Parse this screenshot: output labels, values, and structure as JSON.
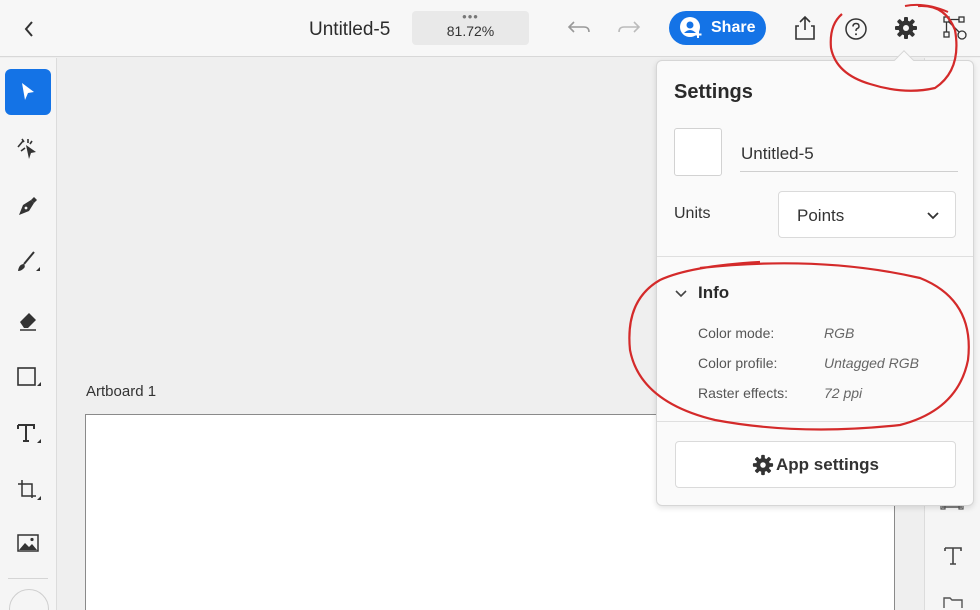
{
  "header": {
    "title": "Untitled-5",
    "zoom_dots": "•••",
    "zoom": "81.72%",
    "share_label": "Share"
  },
  "canvas": {
    "artboard_label": "Artboard 1"
  },
  "settings_panel": {
    "title": "Settings",
    "document_name": "Untitled-5",
    "units_label": "Units",
    "units_value": "Points",
    "info": {
      "title": "Info",
      "rows": [
        {
          "label": "Color mode:",
          "value": "RGB"
        },
        {
          "label": "Color profile:",
          "value": "Untagged RGB"
        },
        {
          "label": "Raster effects:",
          "value": "72 ppi"
        }
      ]
    },
    "app_settings_label": "App settings"
  },
  "tools": [
    "select-tool-icon",
    "direct-select-tool-icon",
    "pen-tool-icon",
    "brush-tool-icon",
    "eraser-tool-icon",
    "rectangle-tool-icon",
    "type-tool-icon",
    "transform-tool-icon",
    "image-tool-icon"
  ],
  "colors": {
    "accent": "#1473e6",
    "annotation": "#d42a2a"
  }
}
